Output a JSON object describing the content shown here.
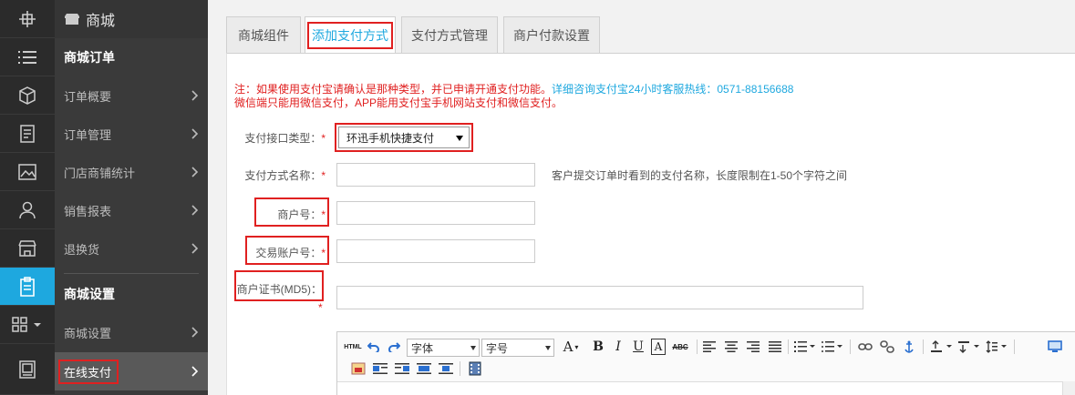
{
  "rail": {
    "icons": [
      "logo-icon",
      "list-icon",
      "cube-icon",
      "document-icon",
      "image-icon",
      "user-icon",
      "store-icon",
      "clipboard-icon",
      "grid-icon",
      "picture-frame-icon"
    ]
  },
  "sidebar": {
    "brand": "商城",
    "section_orders": "商城订单",
    "items_orders": [
      {
        "label": "订单概要"
      },
      {
        "label": "订单管理"
      },
      {
        "label": "门店商铺统计"
      },
      {
        "label": "销售报表"
      },
      {
        "label": "退换货"
      }
    ],
    "section_settings": "商城设置",
    "items_settings": [
      {
        "label": "商城设置"
      },
      {
        "label": "在线支付"
      }
    ]
  },
  "tabs": [
    {
      "label": "商城组件"
    },
    {
      "label": "添加支付方式"
    },
    {
      "label": "支付方式管理"
    },
    {
      "label": "商户付款设置"
    }
  ],
  "notice": {
    "line1_red": "注：如果使用支付宝请确认是那种类型，并已申请开通支付功能。",
    "line1_blue": "详细咨询支付宝24小时客服热线：0571-88156688",
    "line2": "微信端只能用微信支付，APP能用支付宝手机网站支付和微信支付。"
  },
  "form": {
    "type_label": "支付接口类型：",
    "type_value": "环迅手机快捷支付",
    "name_label": "支付方式名称：",
    "name_hint": "客户提交订单时看到的支付名称，长度限制在1-50个字符之间",
    "merchant_label": "商户号：",
    "account_label": "交易账户号：",
    "cert_label": "商户证书(MD5)：",
    "required_mark": "*"
  },
  "editor": {
    "html_label": "HTML",
    "font_family": "字体",
    "font_size": "字号",
    "font_color_label": "A",
    "bold": "B",
    "italic": "I",
    "underline": "U",
    "border_a": "A",
    "strike": "ABC"
  },
  "colors": {
    "accent": "#1ea8df",
    "highlight": "#e02020",
    "sidebar_bg": "#3a3a3a",
    "rail_bg": "#2b2b2b"
  }
}
